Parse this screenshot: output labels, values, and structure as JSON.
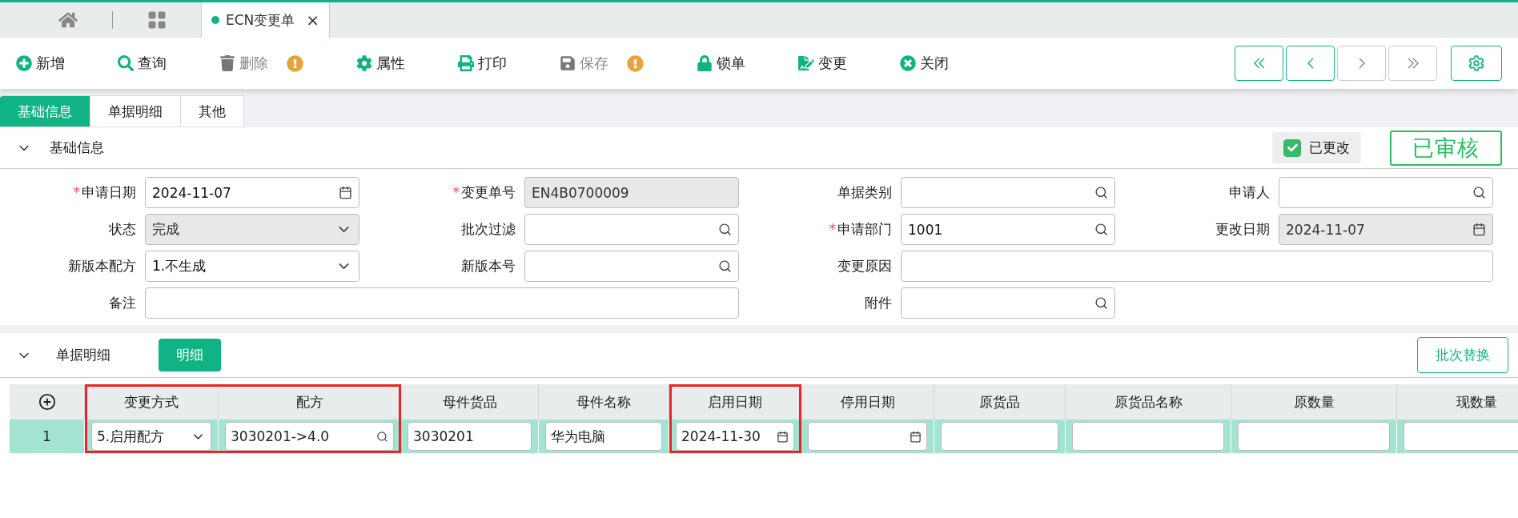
{
  "window_tabs": [
    {
      "kind": "home",
      "selected": false
    },
    {
      "kind": "apps",
      "selected": false
    },
    {
      "kind": "doc",
      "label": "ECN变更单",
      "close": "×",
      "selected": true
    }
  ],
  "toolbar": [
    {
      "kind": "add",
      "label": "新增",
      "disabled": false,
      "warning": false
    },
    {
      "kind": "search",
      "label": "查询",
      "disabled": false,
      "warning": false
    },
    {
      "kind": "delete",
      "label": "删除",
      "disabled": true,
      "warning": true
    },
    {
      "kind": "props",
      "label": "属性",
      "disabled": false,
      "warning": false
    },
    {
      "kind": "print",
      "label": "打印",
      "disabled": false,
      "warning": false
    },
    {
      "kind": "save",
      "label": "保存",
      "disabled": true,
      "warning": true
    },
    {
      "kind": "lock",
      "label": "锁单",
      "disabled": false,
      "warning": false
    },
    {
      "kind": "change",
      "label": "变更",
      "disabled": false,
      "warning": false
    },
    {
      "kind": "close",
      "label": "关闭",
      "disabled": false,
      "warning": false
    }
  ],
  "pager": [
    {
      "kind": "first",
      "disabled": false
    },
    {
      "kind": "prev",
      "disabled": false
    },
    {
      "kind": "next",
      "disabled": true
    },
    {
      "kind": "last",
      "disabled": true
    }
  ],
  "section_tabs": [
    {
      "label": "基础信息",
      "selected": true
    },
    {
      "label": "单据明细",
      "selected": false
    },
    {
      "label": "其他",
      "selected": false
    }
  ],
  "basic": {
    "title": "基础信息",
    "expanded": true,
    "changed": {
      "label": "已更改",
      "checked": true
    },
    "stamp": "已审核",
    "required_mark": "*",
    "fields": [
      {
        "label": "申请日期",
        "required": true,
        "kind": "date",
        "value": "2024-11-07",
        "disabled": false,
        "wide": false
      },
      {
        "label": "变更单号",
        "required": true,
        "kind": "text",
        "value": "EN4B0700009",
        "disabled": true,
        "wide": false
      },
      {
        "label": "单据类别",
        "required": false,
        "kind": "search",
        "disabled": false,
        "wide": false
      },
      {
        "label": "申请人",
        "required": false,
        "kind": "search",
        "disabled": false,
        "wide": false
      },
      {
        "label": "状态",
        "required": false,
        "kind": "select",
        "value": "完成",
        "disabled": true,
        "wide": false
      },
      {
        "label": "批次过滤",
        "required": false,
        "kind": "search",
        "disabled": false,
        "wide": false
      },
      {
        "label": "申请部门",
        "required": true,
        "kind": "search",
        "value": "1001",
        "disabled": false,
        "wide": false
      },
      {
        "label": "更改日期",
        "required": false,
        "kind": "date",
        "value": "2024-11-07",
        "disabled": true,
        "wide": false
      },
      {
        "label": "新版本配方",
        "required": false,
        "kind": "select",
        "value": "1.不生成",
        "disabled": false,
        "wide": false
      },
      {
        "label": "新版本号",
        "required": false,
        "kind": "search",
        "disabled": false,
        "wide": false
      },
      {
        "label": "变更原因",
        "required": false,
        "kind": "text",
        "disabled": false,
        "wide": true
      },
      {
        "label": "备注",
        "required": false,
        "kind": "text",
        "disabled": false,
        "wide": true
      },
      {
        "label": "附件",
        "required": false,
        "kind": "search",
        "disabled": false,
        "wide": false
      }
    ]
  },
  "detail": {
    "title": "单据明细",
    "expanded": true,
    "tab": "明细",
    "batch_button": "批次替换",
    "columns": [
      {
        "label": "变更方式",
        "highlighted": true
      },
      {
        "label": "配方",
        "highlighted": true
      },
      {
        "label": "母件货品",
        "highlighted": false
      },
      {
        "label": "母件名称",
        "highlighted": false
      },
      {
        "label": "启用日期",
        "highlighted": true
      },
      {
        "label": "停用日期",
        "highlighted": false
      },
      {
        "label": "原货品",
        "highlighted": false
      },
      {
        "label": "原货品名称",
        "highlighted": false
      },
      {
        "label": "原数量",
        "highlighted": false
      },
      {
        "label": "现数量",
        "highlighted": false
      }
    ],
    "rows": [
      {
        "number": "1",
        "selected": true,
        "cells": [
          {
            "kind": "select",
            "value": "5.启用配方"
          },
          {
            "kind": "search",
            "value": "3030201->4.0"
          },
          {
            "kind": "text",
            "value": "3030201"
          },
          {
            "kind": "text",
            "value": "华为电脑"
          },
          {
            "kind": "date",
            "value": "2024-11-30"
          },
          {
            "kind": "date"
          },
          {
            "kind": "text"
          },
          {
            "kind": "text"
          },
          {
            "kind": "text"
          },
          {
            "kind": "text"
          }
        ]
      }
    ]
  }
}
